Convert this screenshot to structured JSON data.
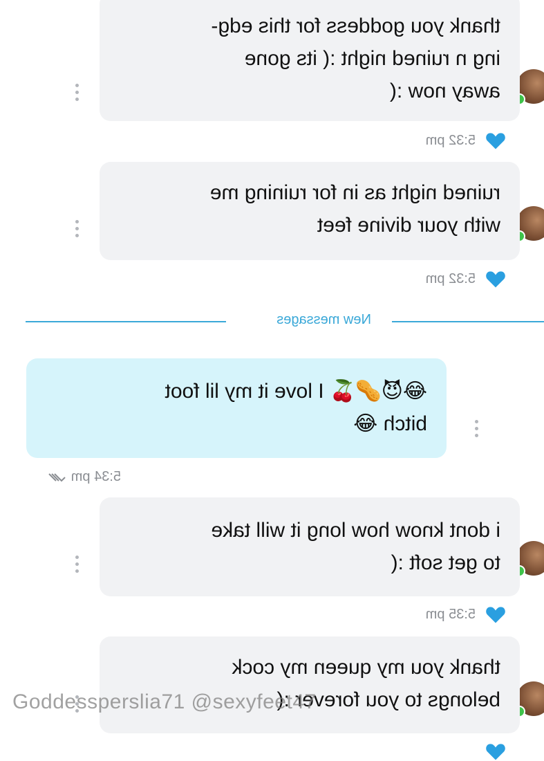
{
  "messages": [
    {
      "lines": [
        "thank you goddess for this edg-",
        "ing n ruined night :( its gone",
        "away now :("
      ],
      "time": "5:32 pm",
      "incoming": true
    },
    {
      "lines": [
        "ruined night as in for ruining me",
        "with your divine feet"
      ],
      "time": "5:32 pm",
      "incoming": true
    },
    {
      "lines": [
        "😂😈🥜🍒 I love it my lil foot",
        "bitch 😂"
      ],
      "time": "5:34 pm",
      "incoming": false
    },
    {
      "lines": [
        "i dont know how long it will take",
        "to get soft :("
      ],
      "time": "5:35 pm",
      "incoming": true
    },
    {
      "lines": [
        "thank you my queen my cock",
        "belongs to you forever :("
      ],
      "time": "",
      "incoming": true
    }
  ],
  "divider": {
    "label": "New messages"
  },
  "watermark": "Goddessperslia71 @sexyfeet47",
  "colors": {
    "incoming_bubble": "#f1f2f4",
    "outgoing_bubble": "#d6f4fb",
    "accent": "#3aa8d8",
    "heart": "#2a9fe0",
    "online": "#3ec34a"
  }
}
